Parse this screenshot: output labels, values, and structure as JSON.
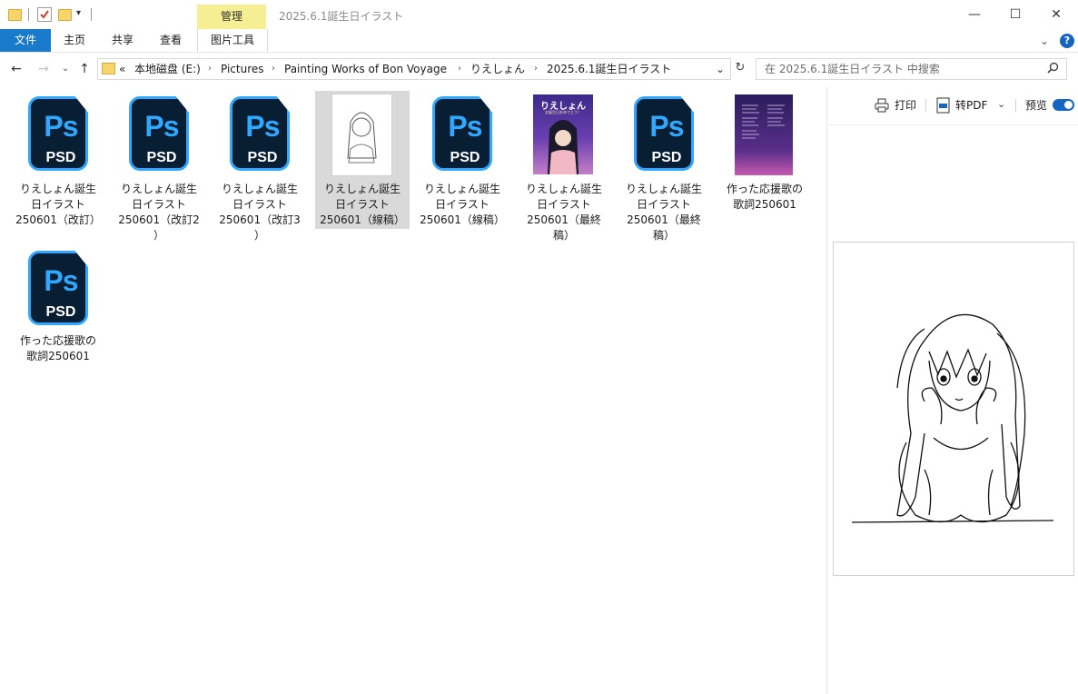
{
  "window": {
    "title": "2025.6.1誕生日イラスト",
    "context_tab": "管理",
    "controls": {
      "minimize": "—",
      "maximize": "☐",
      "close": "✕"
    }
  },
  "ribbon": {
    "tabs": [
      "文件",
      "主页",
      "共享",
      "查看",
      "图片工具"
    ],
    "help": "?"
  },
  "address": {
    "overflow": "«",
    "crumbs": [
      "本地磁盘 (E:)",
      "Pictures",
      "Painting Works of Bon Voyage",
      "りえしょん",
      "2025.6.1誕生日イラスト"
    ],
    "search_placeholder": "在 2025.6.1誕生日イラスト 中搜索"
  },
  "files": [
    {
      "type": "psd",
      "lines": [
        "りえしょん誕生",
        "日イラスト",
        "250601（改訂）"
      ]
    },
    {
      "type": "psd",
      "lines": [
        "りえしょん誕生",
        "日イラスト",
        "250601（改訂2",
        "）"
      ]
    },
    {
      "type": "psd",
      "lines": [
        "りえしょん誕生",
        "日イラスト",
        "250601（改訂3",
        "）"
      ]
    },
    {
      "type": "image-lineart",
      "selected": true,
      "lines": [
        "りえしょん誕生",
        "日イラスト",
        "250601（線稿）"
      ]
    },
    {
      "type": "psd",
      "lines": [
        "りえしょん誕生",
        "日イラスト",
        "250601（線稿）"
      ]
    },
    {
      "type": "image-color",
      "lines": [
        "りえしょん誕生",
        "日イラスト",
        "250601（最終",
        "稿）"
      ]
    },
    {
      "type": "psd",
      "lines": [
        "りえしょん誕生",
        "日イラスト",
        "250601（最終",
        "稿）"
      ]
    },
    {
      "type": "image-lyrics",
      "lines": [
        "作った応援歌の",
        "歌詞250601"
      ]
    },
    {
      "type": "psd",
      "lines": [
        "作った応援歌の",
        "歌詞250601"
      ]
    }
  ],
  "icon_text": {
    "ps": "Ps",
    "psd": "PSD"
  },
  "thumb_text": {
    "title": "りえしょん",
    "subtitle": "お誕生日おめでとう！"
  },
  "preview": {
    "print": "打印",
    "to_pdf": "转PDF",
    "preview_label": "预览",
    "toggle_on": true
  },
  "colors": {
    "accent": "#1979ca",
    "ps_blue": "#31a8ff",
    "ps_bg": "#071e33",
    "context_yellow": "#f6ee92"
  }
}
